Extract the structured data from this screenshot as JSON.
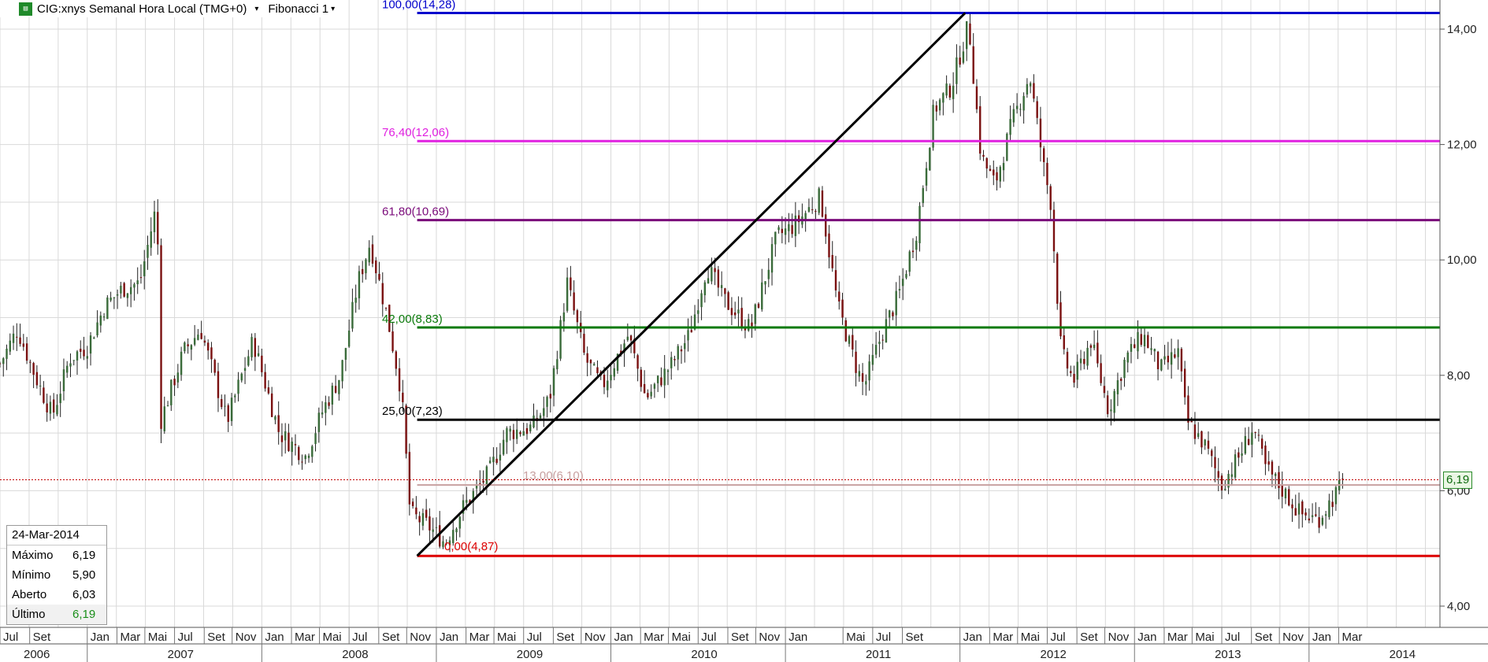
{
  "header": {
    "logo_icon": "data-feed-icon",
    "symbol_label": "CIG:xnys Semanal Hora Local (TMG+0)",
    "symbol_dropdown": "▾",
    "study_label": "Fibonacci 1",
    "study_dropdown": "▾"
  },
  "info_box": {
    "date": "24-Mar-2014",
    "rows": [
      {
        "label": "Máximo",
        "value": "6,19"
      },
      {
        "label": "Mínimo",
        "value": "5,90"
      },
      {
        "label": "Aberto",
        "value": "6,03"
      },
      {
        "label": "Último",
        "value": "6,19"
      }
    ]
  },
  "last_price_tag": "6,19",
  "colors": {
    "candle_up": "#3a6b3a",
    "candle_down": "#7a1010",
    "grid": "#d9d9d9",
    "last_price_line": "#c00000"
  },
  "chart_data": {
    "type": "candlestick",
    "timeframe": "weekly",
    "ylim": [
      3.5,
      14.4
    ],
    "y_ticks": [
      "4,00",
      "6,00",
      "8,00",
      "10,00",
      "12,00",
      "14,00"
    ],
    "x_month_labels": [
      "Jul",
      "Set",
      "Jan",
      "Mar",
      "Mai",
      "Jul",
      "Set",
      "Nov",
      "Jan",
      "Mar",
      "Mai",
      "Jul",
      "Set",
      "Nov",
      "Jan",
      "Mar",
      "Mai",
      "Jul",
      "Set",
      "Nov",
      "Jan",
      "Mar",
      "Mai",
      "Jul",
      "Set",
      "Nov",
      "Jan",
      "Mai",
      "Jul",
      "Set",
      "Jan",
      "Mar",
      "Mai",
      "Jul",
      "Set",
      "Nov",
      "Jan",
      "Mar",
      "Mai",
      "Jul",
      "Set",
      "Nov",
      "Jan",
      "Mar"
    ],
    "x_year_labels": [
      "2006",
      "2007",
      "2008",
      "2009",
      "2010",
      "2011",
      "2012",
      "2013",
      "2014"
    ],
    "fibonacci_levels": [
      {
        "label": "100,00(14,28)",
        "value": 14.28,
        "color": "#0000cc"
      },
      {
        "label": "76,40(12,06)",
        "value": 12.06,
        "color": "#e020e0"
      },
      {
        "label": "61,80(10,69)",
        "value": 10.69,
        "color": "#7a0a7a"
      },
      {
        "label": "42,00(8,83)",
        "value": 8.83,
        "color": "#0a7a0a"
      },
      {
        "label": "25,00(7,23)",
        "value": 7.23,
        "color": "#000000"
      },
      {
        "label": "13,00(6,10)",
        "value": 6.1,
        "color": "#c8a0a0"
      },
      {
        "label": "0,00(4,87)",
        "value": 4.87,
        "color": "#dd0000"
      }
    ],
    "trend_line": {
      "from": {
        "date": "2008-11",
        "price": 4.87
      },
      "to": {
        "date": "2012-02",
        "price": 14.28
      }
    },
    "last_price": 6.19,
    "price_path": [
      [
        2006.5,
        8.2
      ],
      [
        2006.6,
        8.8
      ],
      [
        2006.7,
        8.0
      ],
      [
        2006.8,
        7.3
      ],
      [
        2006.9,
        8.3
      ],
      [
        2007.0,
        8.5
      ],
      [
        2007.1,
        9.2
      ],
      [
        2007.2,
        9.5
      ],
      [
        2007.3,
        9.6
      ],
      [
        2007.4,
        11.0
      ],
      [
        2007.42,
        7.2
      ],
      [
        2007.55,
        8.4
      ],
      [
        2007.65,
        8.8
      ],
      [
        2007.8,
        7.2
      ],
      [
        2007.95,
        8.6
      ],
      [
        2008.1,
        7.0
      ],
      [
        2008.25,
        6.6
      ],
      [
        2008.35,
        7.4
      ],
      [
        2008.45,
        8.0
      ],
      [
        2008.55,
        9.6
      ],
      [
        2008.62,
        10.3
      ],
      [
        2008.72,
        9.0
      ],
      [
        2008.8,
        7.7
      ],
      [
        2008.85,
        5.6
      ],
      [
        2008.95,
        5.4
      ],
      [
        2009.05,
        5.1
      ],
      [
        2009.15,
        5.7
      ],
      [
        2009.3,
        6.3
      ],
      [
        2009.4,
        7.0
      ],
      [
        2009.55,
        7.1
      ],
      [
        2009.65,
        7.6
      ],
      [
        2009.75,
        9.6
      ],
      [
        2009.85,
        8.3
      ],
      [
        2009.95,
        7.8
      ],
      [
        2010.1,
        8.7
      ],
      [
        2010.2,
        7.6
      ],
      [
        2010.35,
        8.2
      ],
      [
        2010.45,
        8.7
      ],
      [
        2010.55,
        9.9
      ],
      [
        2010.65,
        9.3
      ],
      [
        2010.8,
        8.8
      ],
      [
        2010.95,
        10.4
      ],
      [
        2011.05,
        10.6
      ],
      [
        2011.2,
        11.1
      ],
      [
        2011.3,
        9.2
      ],
      [
        2011.4,
        8.2
      ],
      [
        2011.45,
        7.8
      ],
      [
        2011.55,
        8.7
      ],
      [
        2011.65,
        9.4
      ],
      [
        2011.75,
        10.5
      ],
      [
        2011.85,
        12.6
      ],
      [
        2011.95,
        13.0
      ],
      [
        2012.05,
        14.1
      ],
      [
        2012.12,
        11.8
      ],
      [
        2012.2,
        11.3
      ],
      [
        2012.3,
        12.4
      ],
      [
        2012.4,
        13.2
      ],
      [
        2012.48,
        11.6
      ],
      [
        2012.52,
        11.0
      ],
      [
        2012.58,
        8.4
      ],
      [
        2012.65,
        7.9
      ],
      [
        2012.75,
        8.6
      ],
      [
        2012.85,
        7.4
      ],
      [
        2012.95,
        8.3
      ],
      [
        2013.05,
        8.7
      ],
      [
        2013.15,
        8.1
      ],
      [
        2013.25,
        8.4
      ],
      [
        2013.3,
        7.2
      ],
      [
        2013.4,
        6.8
      ],
      [
        2013.5,
        6.1
      ],
      [
        2013.6,
        6.6
      ],
      [
        2013.68,
        7.1
      ],
      [
        2013.75,
        6.4
      ],
      [
        2013.85,
        6.0
      ],
      [
        2013.95,
        5.6
      ],
      [
        2014.05,
        5.5
      ],
      [
        2014.12,
        5.8
      ],
      [
        2014.2,
        6.15
      ]
    ]
  }
}
